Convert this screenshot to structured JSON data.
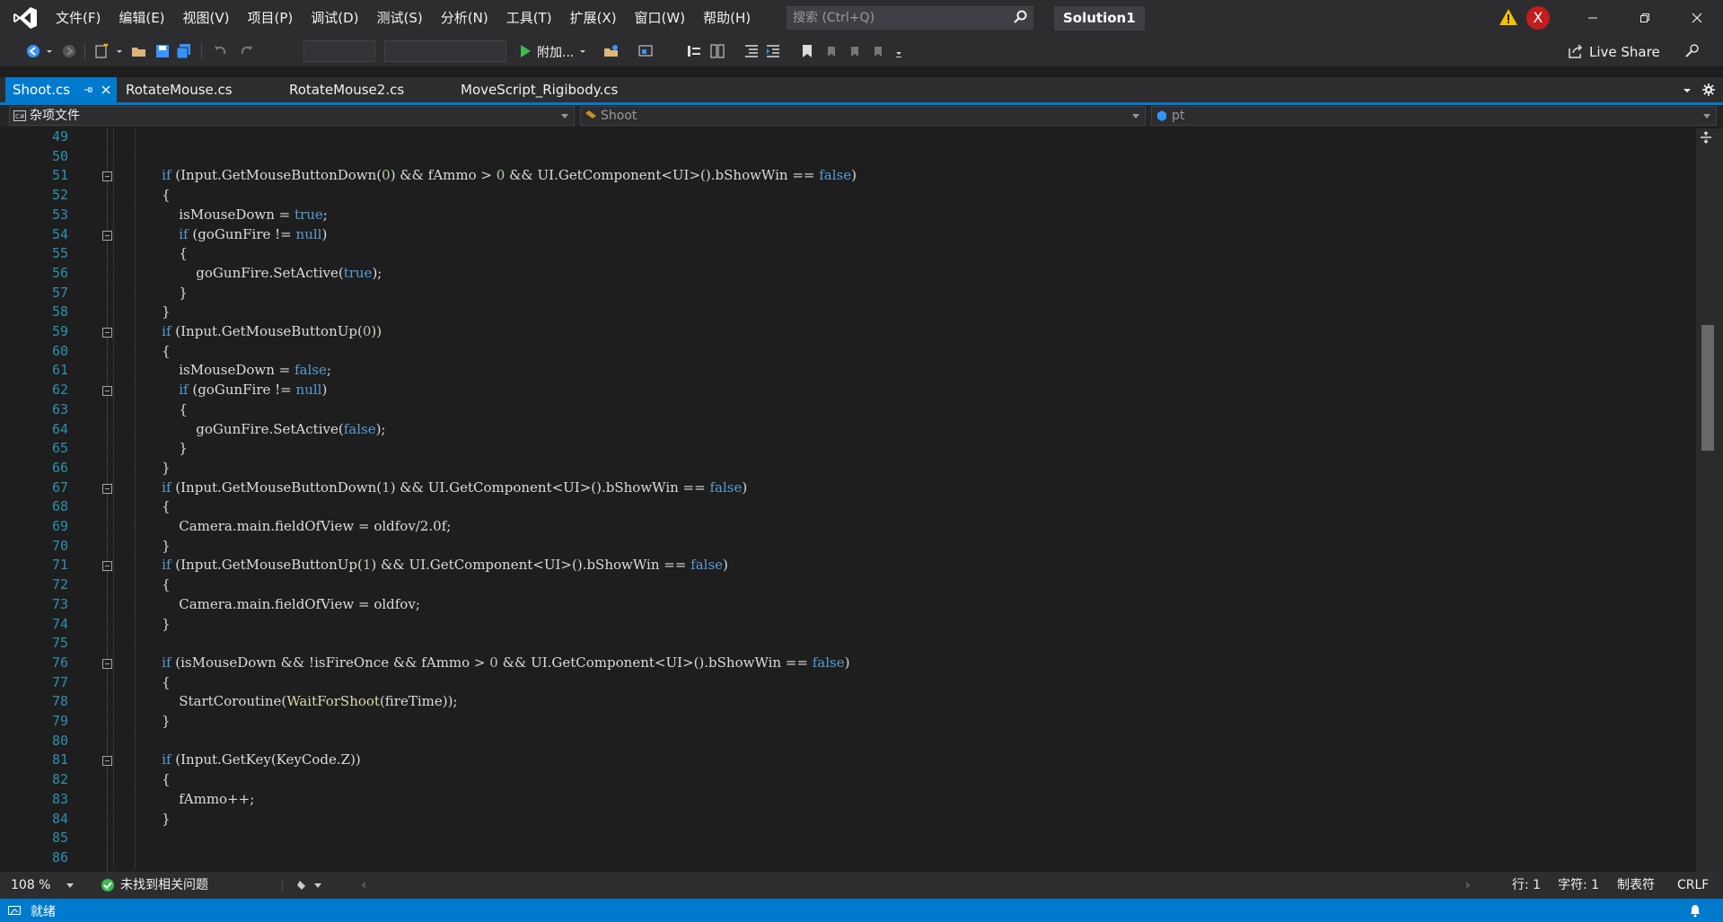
{
  "menu": [
    "文件(F)",
    "编辑(E)",
    "视图(V)",
    "项目(P)",
    "调试(D)",
    "测试(S)",
    "分析(N)",
    "工具(T)",
    "扩展(X)",
    "窗口(W)",
    "帮助(H)"
  ],
  "search": {
    "placeholder": "搜索 (Ctrl+Q)"
  },
  "solution_name": "Solution1",
  "avatar_letter": "X",
  "toolbar": {
    "attach_label": "附加...",
    "live_share_label": "Live Share"
  },
  "tabs": [
    {
      "label": "Shoot.cs",
      "active": true
    },
    {
      "label": "RotateMouse.cs",
      "active": false
    },
    {
      "label": "RotateMouse2.cs",
      "active": false
    },
    {
      "label": "MoveScript_Rigibody.cs",
      "active": false
    }
  ],
  "navbar": {
    "project": "杂项文件",
    "class": "Shoot",
    "member": "pt"
  },
  "code_lines": [
    {
      "n": 49,
      "t": ""
    },
    {
      "n": 50,
      "t": ""
    },
    {
      "n": 51,
      "t": "        if (Input.GetMouseButtonDown(0) && fAmmo > 0 && UI.GetComponent<UI>().bShowWin == false)"
    },
    {
      "n": 52,
      "t": "        {"
    },
    {
      "n": 53,
      "t": "            isMouseDown = true;"
    },
    {
      "n": 54,
      "t": "            if (goGunFire != null)"
    },
    {
      "n": 55,
      "t": "            {"
    },
    {
      "n": 56,
      "t": "                goGunFire.SetActive(true);"
    },
    {
      "n": 57,
      "t": "            }"
    },
    {
      "n": 58,
      "t": "        }"
    },
    {
      "n": 59,
      "t": "        if (Input.GetMouseButtonUp(0))"
    },
    {
      "n": 60,
      "t": "        {"
    },
    {
      "n": 61,
      "t": "            isMouseDown = false;"
    },
    {
      "n": 62,
      "t": "            if (goGunFire != null)"
    },
    {
      "n": 63,
      "t": "            {"
    },
    {
      "n": 64,
      "t": "                goGunFire.SetActive(false);"
    },
    {
      "n": 65,
      "t": "            }"
    },
    {
      "n": 66,
      "t": "        }"
    },
    {
      "n": 67,
      "t": "        if (Input.GetMouseButtonDown(1) && UI.GetComponent<UI>().bShowWin == false)"
    },
    {
      "n": 68,
      "t": "        {"
    },
    {
      "n": 69,
      "t": "            Camera.main.fieldOfView = oldfov/2.0f;"
    },
    {
      "n": 70,
      "t": "        }"
    },
    {
      "n": 71,
      "t": "        if (Input.GetMouseButtonUp(1) && UI.GetComponent<UI>().bShowWin == false)"
    },
    {
      "n": 72,
      "t": "        {"
    },
    {
      "n": 73,
      "t": "            Camera.main.fieldOfView = oldfov;"
    },
    {
      "n": 74,
      "t": "        }"
    },
    {
      "n": 75,
      "t": ""
    },
    {
      "n": 76,
      "t": "        if (isMouseDown && !isFireOnce && fAmmo > 0 && UI.GetComponent<UI>().bShowWin == false)"
    },
    {
      "n": 77,
      "t": "        {"
    },
    {
      "n": 78,
      "t": "            StartCoroutine(WaitForShoot(fireTime));"
    },
    {
      "n": 79,
      "t": "        }"
    },
    {
      "n": 80,
      "t": ""
    },
    {
      "n": 81,
      "t": "        if (Input.GetKey(KeyCode.Z))"
    },
    {
      "n": 82,
      "t": "        {"
    },
    {
      "n": 83,
      "t": "            fAmmo++;"
    },
    {
      "n": 84,
      "t": "        }"
    },
    {
      "n": 85,
      "t": ""
    },
    {
      "n": 86,
      "t": ""
    }
  ],
  "fold_lines": [
    51,
    54,
    59,
    62,
    67,
    71,
    76,
    81
  ],
  "bottom": {
    "zoom": "108 %",
    "issues": "未找到相关问题",
    "line": "行: 1",
    "char": "字符: 1",
    "tabs": "制表符",
    "eol": "CRLF"
  },
  "status": {
    "text": "就绪"
  },
  "colors": {
    "accent": "#007acc",
    "keyword": "#569cd6",
    "line_number": "#2b91af"
  }
}
